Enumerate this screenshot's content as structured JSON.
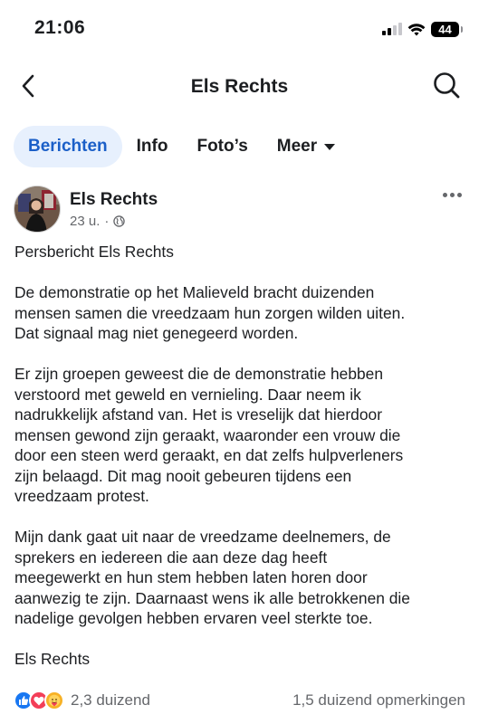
{
  "status_bar": {
    "time": "21:06",
    "battery": "44"
  },
  "header": {
    "title": "Els Rechts",
    "back_icon": "chevron-left-icon",
    "search_icon": "search-icon"
  },
  "tabs": [
    {
      "label": "Berichten",
      "active": true
    },
    {
      "label": "Info",
      "active": false
    },
    {
      "label": "Foto’s",
      "active": false
    },
    {
      "label": "Meer",
      "active": false
    }
  ],
  "post": {
    "author": "Els Rechts",
    "time": "23 u.",
    "separator": "·",
    "audience_icon": "globe-icon",
    "paragraphs": [
      "Persbericht Els Rechts",
      "De demonstratie op het Malieveld bracht duizenden\nmensen samen die vreedzaam hun zorgen wilden uiten.\nDat signaal mag niet genegeerd worden.",
      "Er zijn groepen geweest die de demonstratie hebben\nverstoord met geweld en vernieling. Daar neem ik\nnadrukkelijk afstand van. Het is vreselijk dat hierdoor\nmensen gewond zijn geraakt, waaronder een vrouw die\ndoor een steen werd geraakt, en dat zelfs hulpverleners\nzijn belaagd. Dit mag nooit gebeuren tijdens een\nvreedzaam protest.",
      "Mijn dank gaat uit naar de vreedzame deelnemers, de\nsprekers en iedereen die aan deze dag heeft\nmeegewerkt en hun stem hebben laten horen door\naanwezig te zijn. Daarnaast wens ik alle betrokkenen die\nnadelige gevolgen hebben ervaren veel sterkte toe.",
      "Els Rechts"
    ],
    "reactions": {
      "icons": [
        "like-icon",
        "love-icon",
        "care-icon"
      ],
      "count": "2,3 duizend",
      "comments": "1,5 duizend opmerkingen"
    }
  },
  "colors": {
    "accent": "#1b5fc8",
    "active_tab_bg": "#e7f0fd",
    "secondary_text": "#65676b"
  }
}
